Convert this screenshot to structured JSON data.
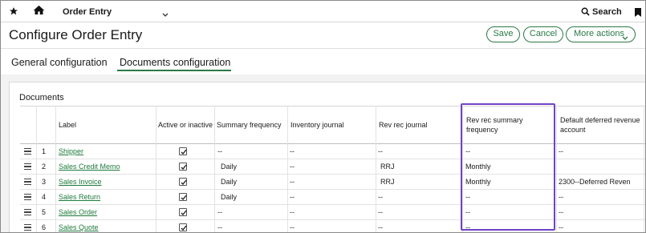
{
  "topbar": {
    "module": "Order Entry",
    "search_label": "Search"
  },
  "header": {
    "title": "Configure Order Entry",
    "save_label": "Save",
    "cancel_label": "Cancel",
    "more_label": "More actions"
  },
  "tabs": [
    {
      "label": "General configuration",
      "active": false
    },
    {
      "label": "Documents configuration",
      "active": true
    }
  ],
  "documents": {
    "section_title": "Documents",
    "columns": [
      "Label",
      "Active or inactive",
      "Summary frequency",
      "Inventory journal",
      "Rev rec journal",
      "Rev rec summary frequency",
      "Default deferred revenue account"
    ],
    "rows": [
      {
        "num": "1",
        "label": "Shipper",
        "active": true,
        "summary_frequency": "--",
        "inventory_journal": "--",
        "rev_rec_journal": "--",
        "rev_rec_summary_frequency": "--",
        "deferred_revenue_account": "--"
      },
      {
        "num": "2",
        "label": "Sales Credit Memo",
        "active": true,
        "summary_frequency": "Daily",
        "inventory_journal": "--",
        "rev_rec_journal": "RRJ",
        "rev_rec_summary_frequency": "Monthly",
        "deferred_revenue_account": ""
      },
      {
        "num": "3",
        "label": "Sales Invoice",
        "active": true,
        "summary_frequency": "Daily",
        "inventory_journal": "--",
        "rev_rec_journal": "RRJ",
        "rev_rec_summary_frequency": "Monthly",
        "deferred_revenue_account": "2300--Deferred Reven"
      },
      {
        "num": "4",
        "label": "Sales Return",
        "active": true,
        "summary_frequency": "Daily",
        "inventory_journal": "--",
        "rev_rec_journal": "--",
        "rev_rec_summary_frequency": "--",
        "deferred_revenue_account": "--"
      },
      {
        "num": "5",
        "label": "Sales Order",
        "active": true,
        "summary_frequency": "--",
        "inventory_journal": "--",
        "rev_rec_journal": "--",
        "rev_rec_summary_frequency": "--",
        "deferred_revenue_account": "--"
      },
      {
        "num": "6",
        "label": "Sales Quote",
        "active": true,
        "summary_frequency": "--",
        "inventory_journal": "--",
        "rev_rec_journal": "--",
        "rev_rec_summary_frequency": "--",
        "deferred_revenue_account": "--"
      }
    ]
  },
  "colors": {
    "accent": "#2a7a46",
    "link": "#1e7a3c",
    "highlight": "#7044c4"
  }
}
